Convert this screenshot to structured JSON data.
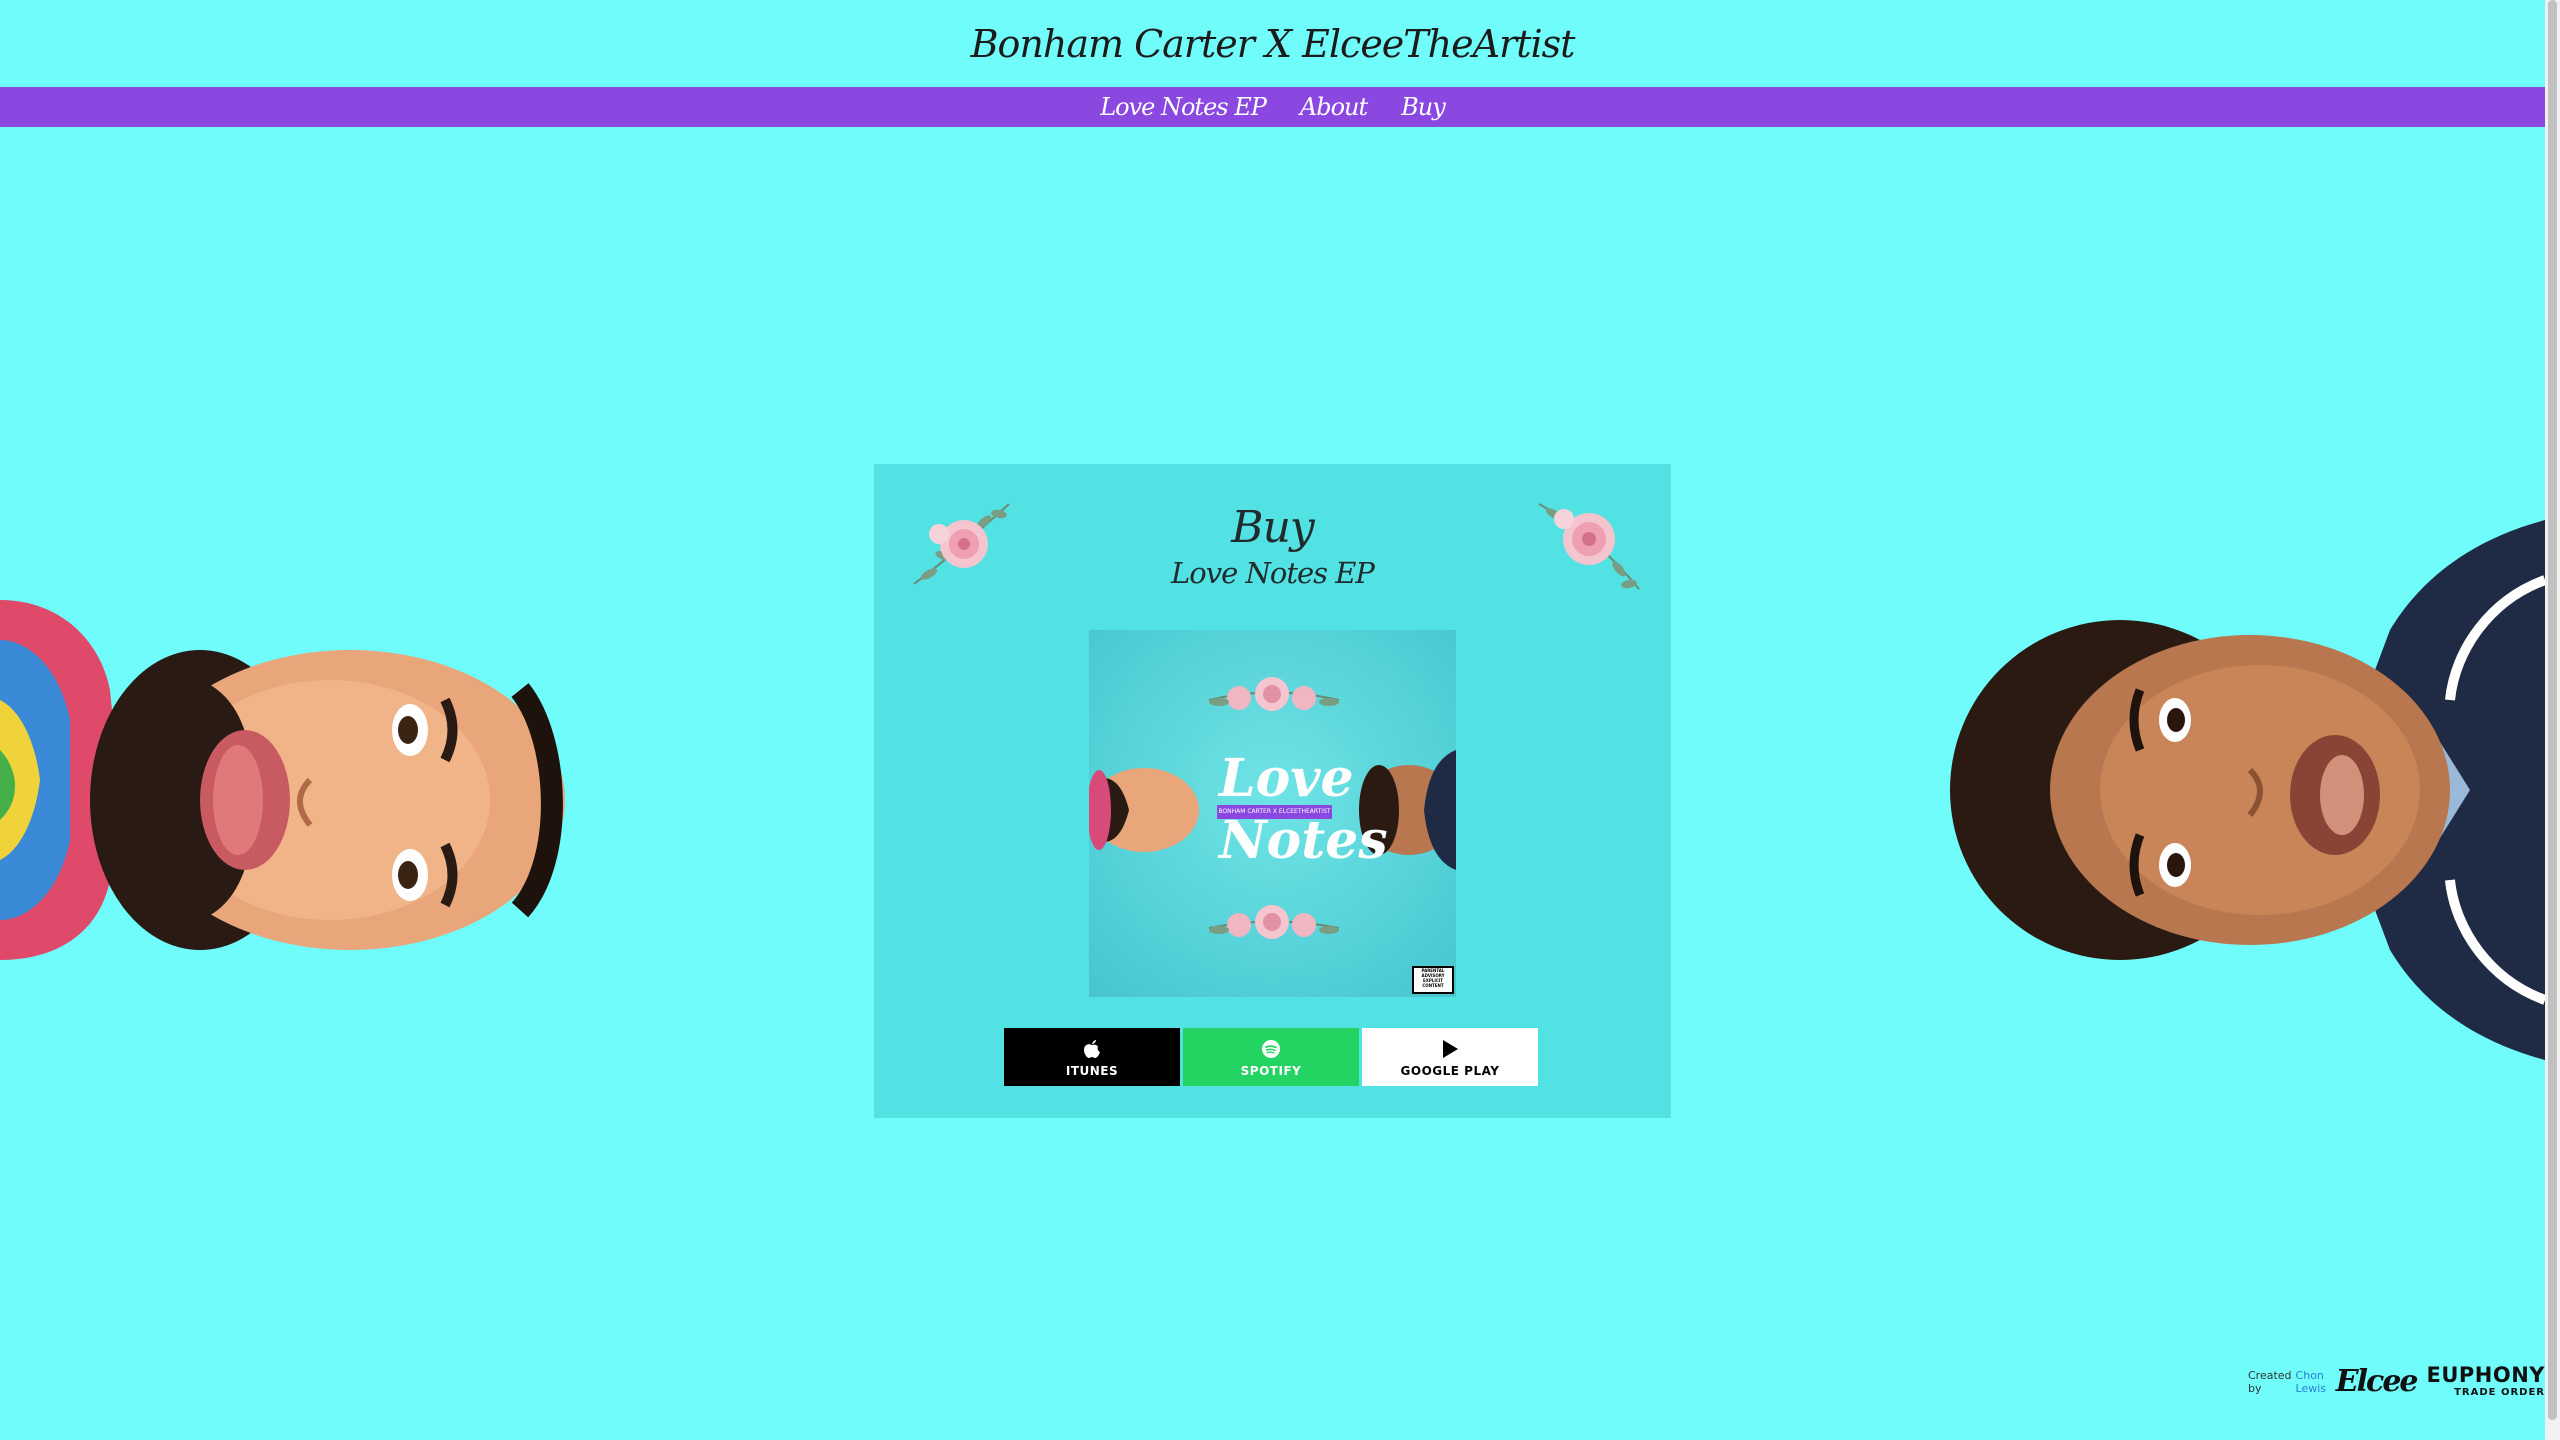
{
  "header": {
    "site_title": "Bonham Carter X ElceeTheArtist"
  },
  "nav": {
    "items": [
      {
        "label": "Love Notes EP"
      },
      {
        "label": "About"
      },
      {
        "label": "Buy"
      }
    ]
  },
  "card": {
    "title": "Buy",
    "subtitle": "Love Notes EP",
    "album_cover": {
      "title_line1": "Love",
      "title_line2": "Notes",
      "banner": "BONHAM CARTER X ELCEETHEARTIST",
      "advisory": "PARENTAL ADVISORY EXPLICIT CONTENT"
    },
    "buttons": [
      {
        "label": "ITUNES",
        "icon": "apple-icon"
      },
      {
        "label": "SPOTIFY",
        "icon": "spotify-icon"
      },
      {
        "label": "GOOGLE PLAY",
        "icon": "play-icon"
      }
    ]
  },
  "footer": {
    "created_by": "Created by",
    "author": "Chon Lewis",
    "logo_elcee": "Elcee",
    "logo_euphony": "EUPHONY",
    "logo_euphony_sub": "TRADE ORDER"
  },
  "colors": {
    "background": "#6ffcfb",
    "nav": "#8a48e0",
    "card": "#53e2e3",
    "itunes": "#000000",
    "spotify": "#23d462",
    "google_play": "#ffffff"
  }
}
